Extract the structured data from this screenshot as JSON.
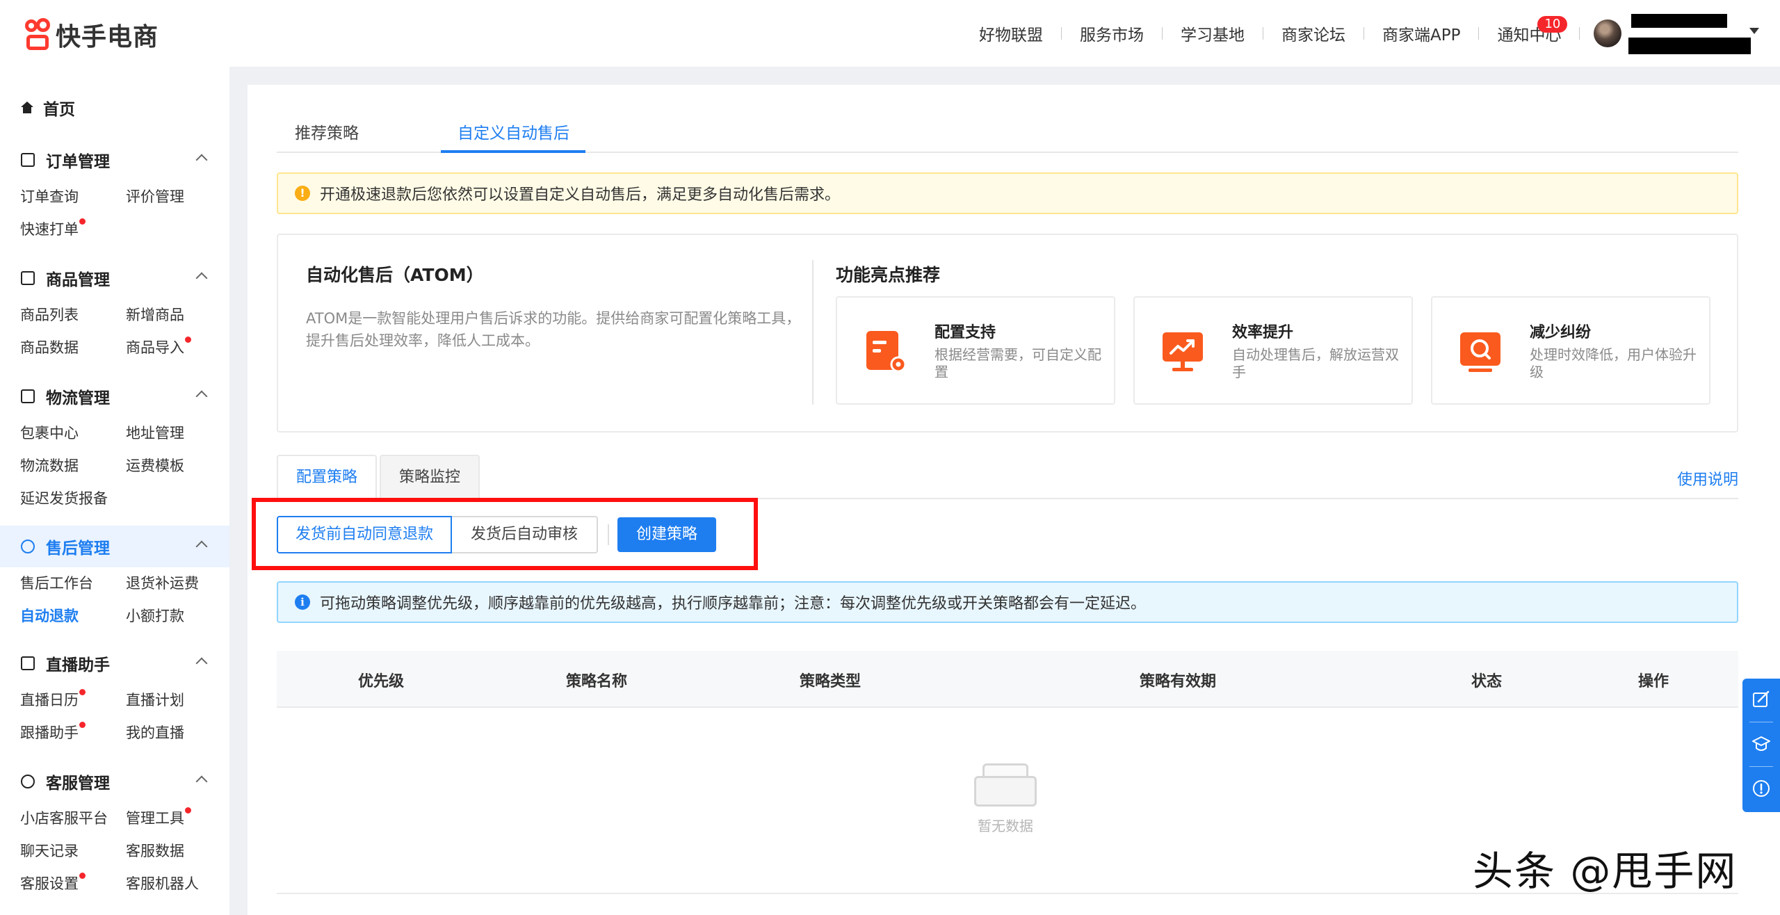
{
  "header": {
    "logo_text": "快手电商",
    "nav": [
      "好物联盟",
      "服务市场",
      "学习基地",
      "商家论坛",
      "商家端APP",
      "通知中心"
    ],
    "notice_count": "10"
  },
  "sidebar": {
    "home": "首页",
    "groups": [
      {
        "title": "订单管理",
        "items": [
          {
            "label": "订单查询",
            "dot": false
          },
          {
            "label": "评价管理",
            "dot": false
          },
          {
            "label": "快速打单",
            "dot": true
          }
        ]
      },
      {
        "title": "商品管理",
        "items": [
          {
            "label": "商品列表",
            "dot": false
          },
          {
            "label": "新增商品",
            "dot": false
          },
          {
            "label": "商品数据",
            "dot": false
          },
          {
            "label": "商品导入",
            "dot": true
          }
        ]
      },
      {
        "title": "物流管理",
        "items": [
          {
            "label": "包裹中心",
            "dot": false
          },
          {
            "label": "地址管理",
            "dot": false
          },
          {
            "label": "物流数据",
            "dot": false
          },
          {
            "label": "运费模板",
            "dot": false
          },
          {
            "label": "延迟发货报备",
            "dot": false
          }
        ]
      },
      {
        "title": "售后管理",
        "active": true,
        "items": [
          {
            "label": "售后工作台",
            "dot": false
          },
          {
            "label": "退货补运费",
            "dot": false
          },
          {
            "label": "自动退款",
            "dot": false,
            "active": true
          },
          {
            "label": "小额打款",
            "dot": false
          }
        ]
      },
      {
        "title": "直播助手",
        "items": [
          {
            "label": "直播日历",
            "dot": true
          },
          {
            "label": "直播计划",
            "dot": false
          },
          {
            "label": "跟播助手",
            "dot": true
          },
          {
            "label": "我的直播",
            "dot": false
          }
        ]
      },
      {
        "title": "客服管理",
        "items": [
          {
            "label": "小店客服平台",
            "dot": false
          },
          {
            "label": "管理工具",
            "dot": true
          },
          {
            "label": "聊天记录",
            "dot": false
          },
          {
            "label": "客服数据",
            "dot": false
          },
          {
            "label": "客服设置",
            "dot": true
          },
          {
            "label": "客服机器人",
            "dot": false
          }
        ]
      }
    ]
  },
  "main": {
    "tabs": [
      "推荐策略",
      "自定义自动售后"
    ],
    "alert_text": "开通极速退款后您依然可以设置自定义自动售后，满足更多自动化售后需求。",
    "intro": {
      "title": "自动化售后（ATOM）",
      "desc": "ATOM是一款智能处理用户售后诉求的功能。提供给商家可配置化策略工具，提升售后处理效率，降低人工成本。",
      "features_title": "功能亮点推荐",
      "features": [
        {
          "name": "配置支持",
          "desc": "根据经营需要，可自定义配置",
          "icon": "config-doc-icon"
        },
        {
          "name": "效率提升",
          "desc": "自动处理售后，解放运营双手",
          "icon": "trend-chart-icon"
        },
        {
          "name": "减少纠纷",
          "desc": "处理时效降低，用户体验升级",
          "icon": "search-screen-icon"
        }
      ]
    },
    "subtabs": [
      "配置策略",
      "策略监控"
    ],
    "help_link": "使用说明",
    "segments": [
      "发货前自动同意退款",
      "发货后自动审核"
    ],
    "create_button": "创建策略",
    "info_text": "可拖动策略调整优先级，顺序越靠前的优先级越高，执行顺序越靠前；注意：每次调整优先级或开关策略都会有一定延迟。",
    "table": {
      "columns": [
        "优先级",
        "策略名称",
        "策略类型",
        "策略有效期",
        "状态",
        "操作"
      ],
      "empty_text": "暂无数据"
    }
  },
  "colors": {
    "accent": "#1e7ef0",
    "brand": "#fe3a2f",
    "feature_orange": "#fa5a1e",
    "highlight_box": "#ff0f0f"
  },
  "watermark": "头条 @甩手网"
}
